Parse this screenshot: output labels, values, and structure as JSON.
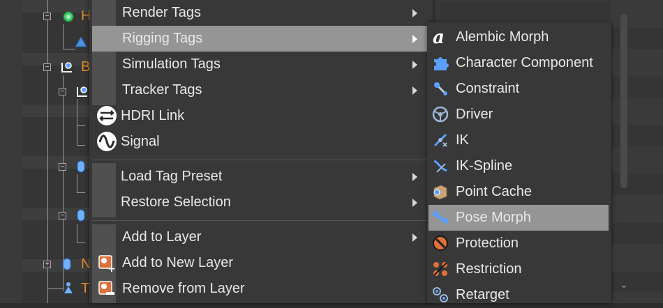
{
  "tree": {
    "labels": [
      "H",
      "B",
      "N",
      "T"
    ]
  },
  "main_menu": {
    "items": [
      {
        "label": "Render Tags",
        "submenu": true
      },
      {
        "label": "Rigging Tags",
        "submenu": true,
        "highlighted": true
      },
      {
        "label": "Simulation Tags",
        "submenu": true
      },
      {
        "label": "Tracker Tags",
        "submenu": true
      },
      {
        "label": "HDRI Link",
        "icon": "hdri-link-icon"
      },
      {
        "label": "Signal",
        "icon": "signal-icon"
      },
      {
        "label": "Load Tag Preset",
        "submenu": true
      },
      {
        "label": "Restore Selection",
        "submenu": true
      },
      {
        "label": "Add to Layer",
        "submenu": true
      },
      {
        "label": "Add to New Layer",
        "icon": "add-to-new-layer-icon"
      },
      {
        "label": "Remove from Layer",
        "icon": "remove-from-layer-icon"
      }
    ]
  },
  "rigging_submenu": {
    "items": [
      {
        "label": "Alembic Morph",
        "icon": "alembic-morph-icon"
      },
      {
        "label": "Character Component",
        "icon": "character-component-icon"
      },
      {
        "label": "Constraint",
        "icon": "constraint-icon"
      },
      {
        "label": "Driver",
        "icon": "driver-icon"
      },
      {
        "label": "IK",
        "icon": "ik-icon"
      },
      {
        "label": "IK-Spline",
        "icon": "ik-spline-icon"
      },
      {
        "label": "Point Cache",
        "icon": "point-cache-icon"
      },
      {
        "label": "Pose Morph",
        "icon": "pose-morph-icon",
        "highlighted": true
      },
      {
        "label": "Protection",
        "icon": "protection-icon"
      },
      {
        "label": "Restriction",
        "icon": "restriction-icon"
      },
      {
        "label": "Retarget",
        "icon": "retarget-icon"
      }
    ]
  },
  "colors": {
    "highlight": "#959595",
    "menu_bg": "#383838",
    "object_label": "#e08a2a"
  }
}
